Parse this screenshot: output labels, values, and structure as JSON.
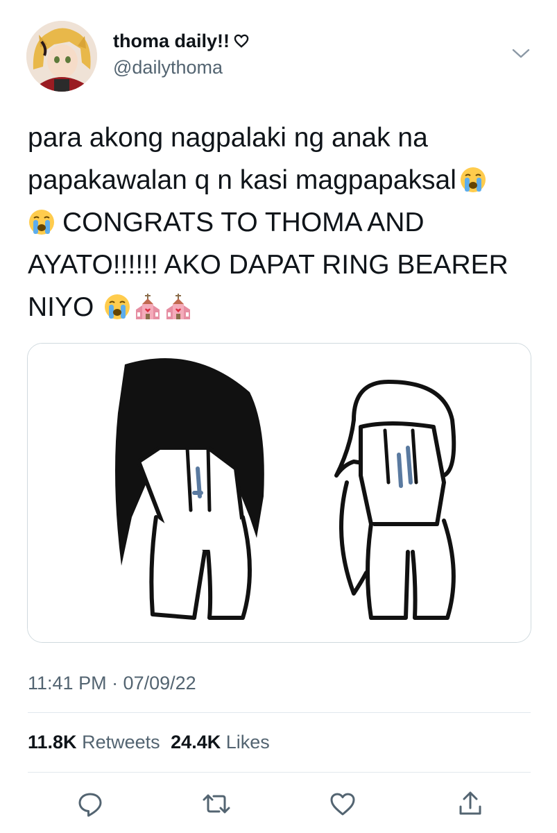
{
  "profile": {
    "display_name": "thoma daily!!",
    "handle": "@dailythoma"
  },
  "tweet": {
    "lines": [
      "para akong nagpalaki ng anak na",
      "papakawalan q n kasi magpapaksal",
      "CONGRATS TO THOMA AND",
      "AYATO!!!!!! AKO DAPAT RING BEARER",
      "NIYO"
    ],
    "emojis": [
      "crying-face-emoji",
      "crying-face-emoji",
      "crying-face-emoji",
      "wedding-chapel-emoji",
      "wedding-chapel-emoji"
    ]
  },
  "timestamp": "11:41 PM · 07/09/22",
  "stats": {
    "retweets_count": "11.8K",
    "retweets_label": "Retweets",
    "likes_count": "24.4K",
    "likes_label": "Likes"
  },
  "actions": [
    "reply-icon",
    "retweet-icon",
    "like-icon",
    "share-icon"
  ],
  "colors": {
    "text": "#0f1419",
    "secondary": "#536471",
    "divider": "#e1e8ed",
    "action_icon": "#536471"
  }
}
